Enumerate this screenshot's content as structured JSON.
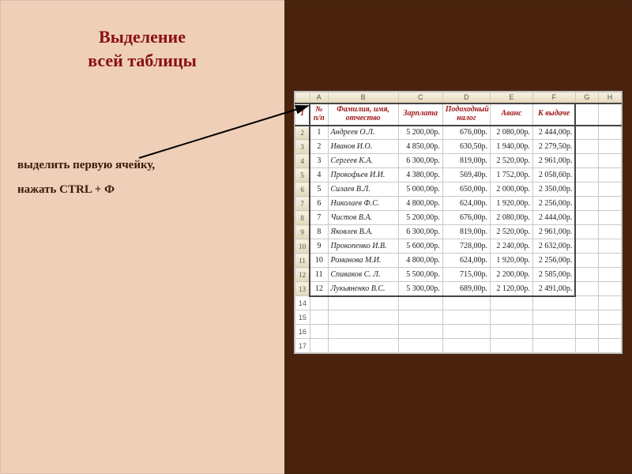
{
  "title_line1": "Выделение",
  "title_line2": "всей таблицы",
  "instruction_line1": "выделить первую ячейку,",
  "instruction_line2": "нажать CTRL + Ф",
  "columns": [
    "A",
    "B",
    "C",
    "D",
    "E",
    "F",
    "G",
    "H"
  ],
  "headers": {
    "A": "№ п/п",
    "B": "Фамилия, имя, отчество",
    "C": "Зарплата",
    "D": "Подоходный налог",
    "E": "Аванс",
    "F": "К выдаче"
  },
  "rows": [
    {
      "n": "1",
      "name": "Андреев О.Л.",
      "c": "5 200,00р.",
      "d": "676,00р.",
      "e": "2 080,00р.",
      "f": "2 444,00р."
    },
    {
      "n": "2",
      "name": "Иванов И.О.",
      "c": "4 850,00р.",
      "d": "630,50р.",
      "e": "1 940,00р.",
      "f": "2 279,50р."
    },
    {
      "n": "3",
      "name": "Сергеев К.А.",
      "c": "6 300,00р.",
      "d": "819,00р.",
      "e": "2 520,00р.",
      "f": "2 961,00р."
    },
    {
      "n": "4",
      "name": "Прокофьев И.И.",
      "c": "4 380,00р.",
      "d": "569,40р.",
      "e": "1 752,00р.",
      "f": "2 058,60р."
    },
    {
      "n": "5",
      "name": "Силаев В.Л.",
      "c": "5 000,00р.",
      "d": "650,00р.",
      "e": "2 000,00р.",
      "f": "2 350,00р."
    },
    {
      "n": "6",
      "name": "Николаев Ф.С.",
      "c": "4 800,00р.",
      "d": "624,00р.",
      "e": "1 920,00р.",
      "f": "2 256,00р."
    },
    {
      "n": "7",
      "name": "Чистов В.А.",
      "c": "5 200,00р.",
      "d": "676,00р.",
      "e": "2 080,00р.",
      "f": "2 444,00р."
    },
    {
      "n": "8",
      "name": "Яковлев В.А.",
      "c": "6 300,00р.",
      "d": "819,00р.",
      "e": "2 520,00р.",
      "f": "2 961,00р."
    },
    {
      "n": "9",
      "name": "Прокопенко И.В.",
      "c": "5 600,00р.",
      "d": "728,00р.",
      "e": "2 240,00р.",
      "f": "2 632,00р."
    },
    {
      "n": "10",
      "name": "Романова М.И.",
      "c": "4 800,00р.",
      "d": "624,00р.",
      "e": "1 920,00р.",
      "f": "2 256,00р."
    },
    {
      "n": "11",
      "name": "Спиваков С. Л.",
      "c": "5 500,00р.",
      "d": "715,00р.",
      "e": "2 200,00р.",
      "f": "2 585,00р."
    },
    {
      "n": "12",
      "name": "Лукьяненко В.С.",
      "c": "5 300,00р.",
      "d": "689,00р.",
      "e": "2 120,00р.",
      "f": "2 491,00р."
    }
  ],
  "empty_rownums": [
    "13",
    "14",
    "15",
    "16"
  ]
}
